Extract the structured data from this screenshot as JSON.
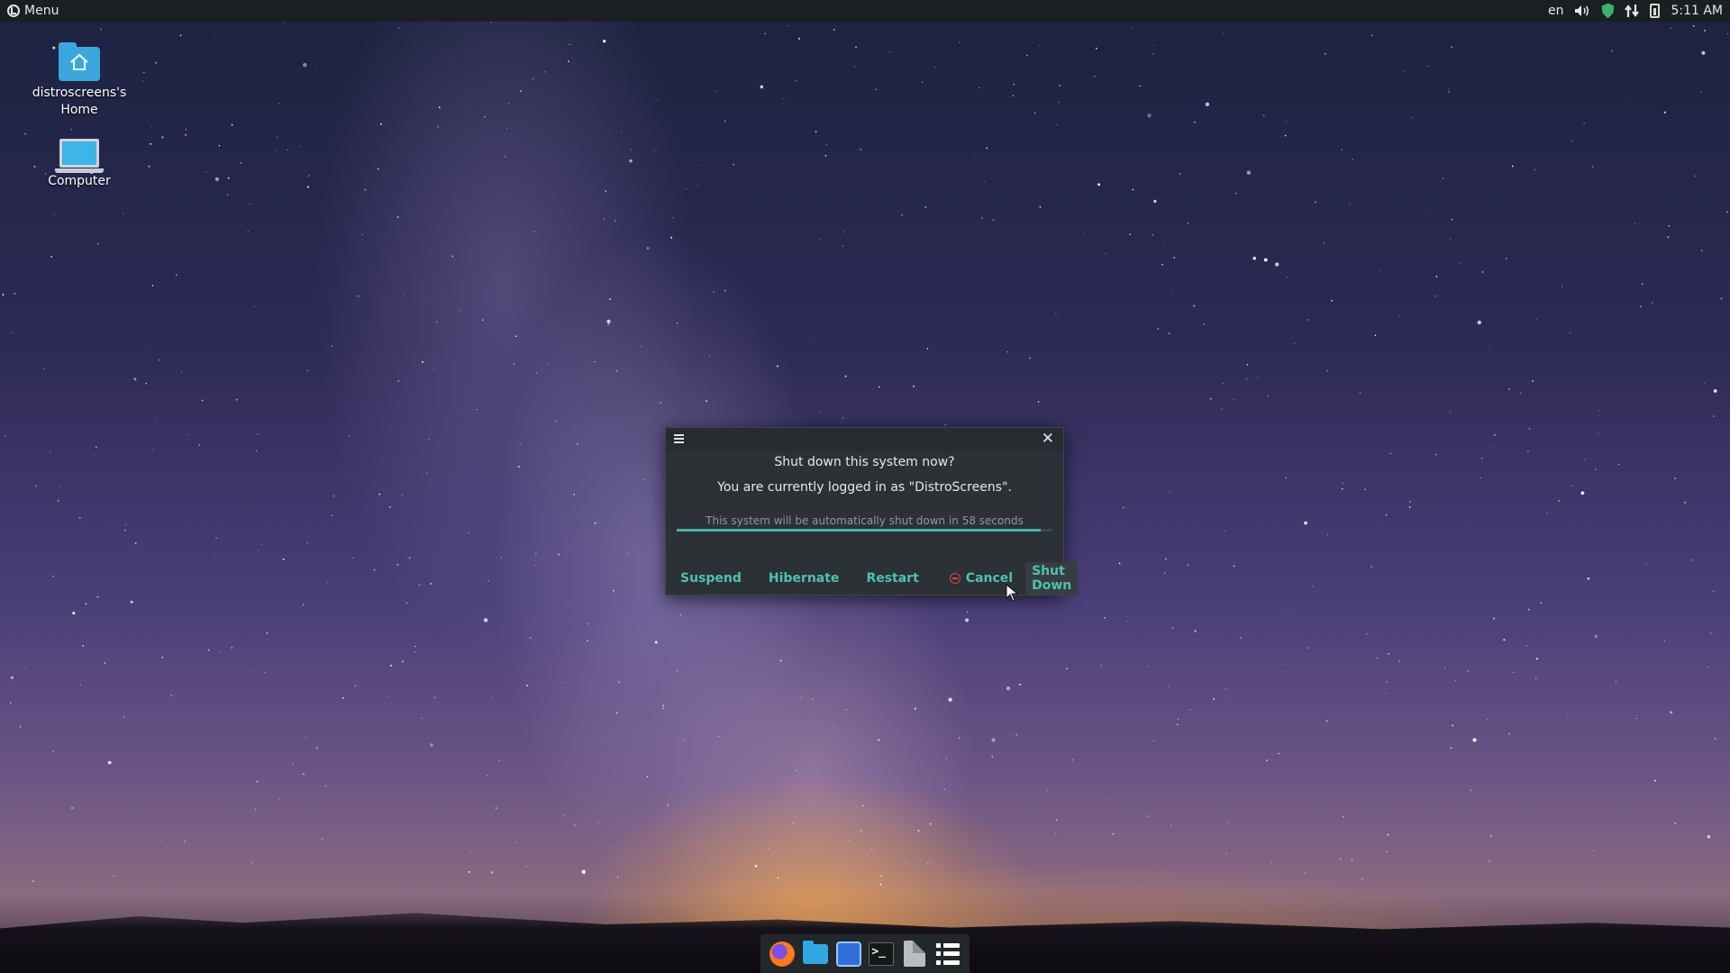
{
  "top_panel": {
    "menu_label": "Menu",
    "tray": {
      "keyboard_layout": "en",
      "icons": [
        "volume-icon",
        "shield-icon",
        "network-icon",
        "battery-icon"
      ],
      "clock": "5:11 AM"
    }
  },
  "desktop": {
    "icons": [
      {
        "label": "distroscreens's Home",
        "icon": "home-folder-icon"
      },
      {
        "label": "Computer",
        "icon": "computer-icon"
      }
    ]
  },
  "dialog": {
    "question": "Shut down this system now?",
    "user_message": "You are currently logged in as \"DistroScreens\".",
    "countdown": "This system will be automatically shut down in 58 seconds",
    "countdown_progress": 0.97,
    "accent_color": "#3fb7a5",
    "buttons": {
      "suspend": "Suspend",
      "hibernate": "Hibernate",
      "restart": "Restart",
      "cancel": "Cancel",
      "shutdown": "Shut Down"
    }
  },
  "dock": {
    "items": [
      "firefox-icon",
      "files-icon",
      "email-icon",
      "terminal-icon",
      "text-editor-icon",
      "task-list-icon"
    ],
    "terminal_glyph": ">_"
  }
}
